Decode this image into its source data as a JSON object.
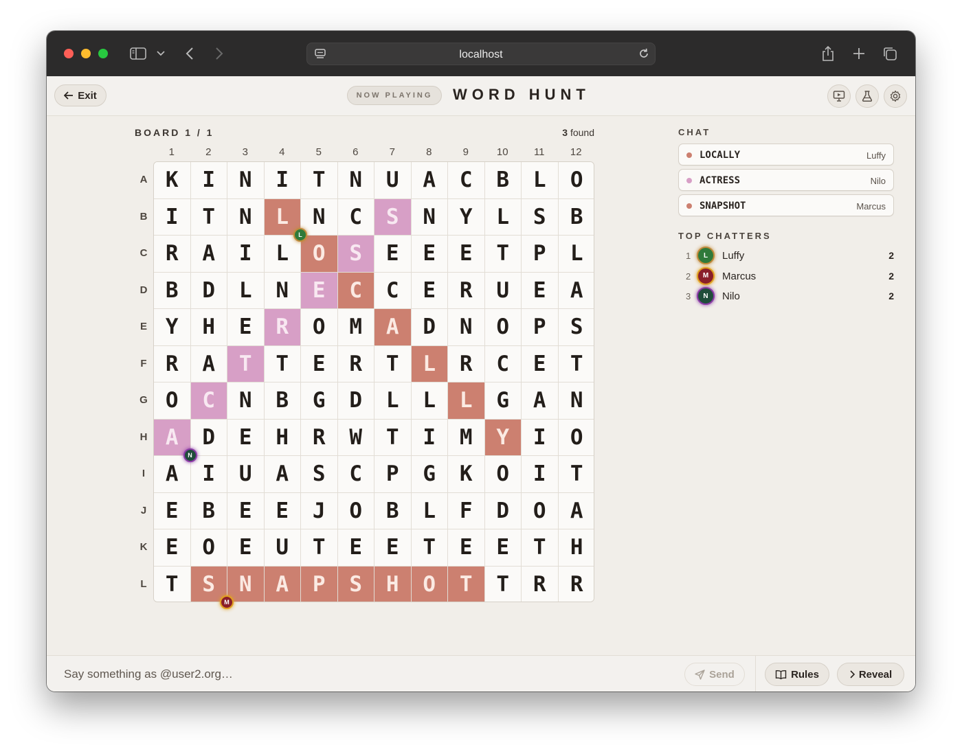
{
  "browser": {
    "url": "localhost"
  },
  "header": {
    "exit_label": "Exit",
    "now_playing": "NOW PLAYING",
    "title": "WORD HUNT"
  },
  "board": {
    "label": "BOARD 1 / 1",
    "found_count": "3",
    "found_suffix": " found",
    "columns": [
      "1",
      "2",
      "3",
      "4",
      "5",
      "6",
      "7",
      "8",
      "9",
      "10",
      "11",
      "12"
    ],
    "rows": [
      "A",
      "B",
      "C",
      "D",
      "E",
      "F",
      "G",
      "H",
      "I",
      "J",
      "K",
      "L"
    ],
    "letters": [
      [
        "K",
        "I",
        "N",
        "I",
        "T",
        "N",
        "U",
        "A",
        "C",
        "B",
        "L",
        "O"
      ],
      [
        "I",
        "T",
        "N",
        "L",
        "N",
        "C",
        "S",
        "N",
        "Y",
        "L",
        "S",
        "B"
      ],
      [
        "R",
        "A",
        "I",
        "L",
        "O",
        "S",
        "E",
        "E",
        "E",
        "T",
        "P",
        "L"
      ],
      [
        "B",
        "D",
        "L",
        "N",
        "E",
        "C",
        "C",
        "E",
        "R",
        "U",
        "E",
        "A"
      ],
      [
        "Y",
        "H",
        "E",
        "R",
        "O",
        "M",
        "A",
        "D",
        "N",
        "O",
        "P",
        "S"
      ],
      [
        "R",
        "A",
        "T",
        "T",
        "E",
        "R",
        "T",
        "L",
        "R",
        "C",
        "E",
        "T"
      ],
      [
        "O",
        "C",
        "N",
        "B",
        "G",
        "D",
        "L",
        "L",
        "L",
        "G",
        "A",
        "N"
      ],
      [
        "A",
        "D",
        "E",
        "H",
        "R",
        "W",
        "T",
        "I",
        "M",
        "Y",
        "I",
        "O"
      ],
      [
        "A",
        "I",
        "U",
        "A",
        "S",
        "C",
        "P",
        "G",
        "K",
        "O",
        "I",
        "T"
      ],
      [
        "E",
        "B",
        "E",
        "E",
        "J",
        "O",
        "B",
        "L",
        "F",
        "D",
        "O",
        "A"
      ],
      [
        "E",
        "O",
        "E",
        "U",
        "T",
        "E",
        "E",
        "T",
        "E",
        "E",
        "T",
        "H"
      ],
      [
        "T",
        "S",
        "N",
        "A",
        "P",
        "S",
        "H",
        "O",
        "T",
        "T",
        "R",
        "R"
      ]
    ],
    "highlights": [
      {
        "word": "LOCALLY",
        "color": "#cc8070",
        "cells": [
          [
            1,
            3
          ],
          [
            2,
            4
          ],
          [
            3,
            5
          ],
          [
            4,
            6
          ],
          [
            5,
            7
          ],
          [
            6,
            8
          ],
          [
            7,
            9
          ]
        ]
      },
      {
        "word": "ACTRESS",
        "color": "#d79fc6",
        "cells": [
          [
            7,
            0
          ],
          [
            6,
            1
          ],
          [
            5,
            2
          ],
          [
            4,
            3
          ],
          [
            3,
            4
          ],
          [
            2,
            5
          ],
          [
            1,
            6
          ]
        ]
      },
      {
        "word": "SNAPSHOT",
        "color": "#cc8070",
        "cells": [
          [
            11,
            1
          ],
          [
            11,
            2
          ],
          [
            11,
            3
          ],
          [
            11,
            4
          ],
          [
            11,
            5
          ],
          [
            11,
            6
          ],
          [
            11,
            7
          ],
          [
            11,
            8
          ]
        ]
      }
    ],
    "markers": [
      {
        "initial": "L",
        "bg": "#2f7a3a",
        "ring": "#c08a3a",
        "at": [
          1,
          3
        ]
      },
      {
        "initial": "N",
        "bg": "#1f4d3a",
        "ring": "#8b3aa6",
        "at": [
          7,
          0
        ]
      },
      {
        "initial": "M",
        "bg": "#8a1f2a",
        "ring": "#e0a020",
        "at": [
          11,
          1
        ]
      }
    ]
  },
  "chat": {
    "title": "CHAT",
    "messages": [
      {
        "word": "LOCALLY",
        "user": "Luffy",
        "dot": "#cc8070"
      },
      {
        "word": "ACTRESS",
        "user": "Nilo",
        "dot": "#d79fc6"
      },
      {
        "word": "SNAPSHOT",
        "user": "Marcus",
        "dot": "#cc8070"
      }
    ]
  },
  "top_chatters": {
    "title": "TOP CHATTERS",
    "list": [
      {
        "rank": "1",
        "initial": "L",
        "name": "Luffy",
        "score": "2",
        "bg": "#2f7a3a",
        "ring": "#c08a3a"
      },
      {
        "rank": "2",
        "initial": "M",
        "name": "Marcus",
        "score": "2",
        "bg": "#8a1f2a",
        "ring": "#e0a020"
      },
      {
        "rank": "3",
        "initial": "N",
        "name": "Nilo",
        "score": "2",
        "bg": "#1f4d3a",
        "ring": "#8b3aa6"
      }
    ]
  },
  "footer": {
    "placeholder": "Say something as @user2.org…",
    "send_label": "Send",
    "rules_label": "Rules",
    "reveal_label": "Reveal"
  }
}
